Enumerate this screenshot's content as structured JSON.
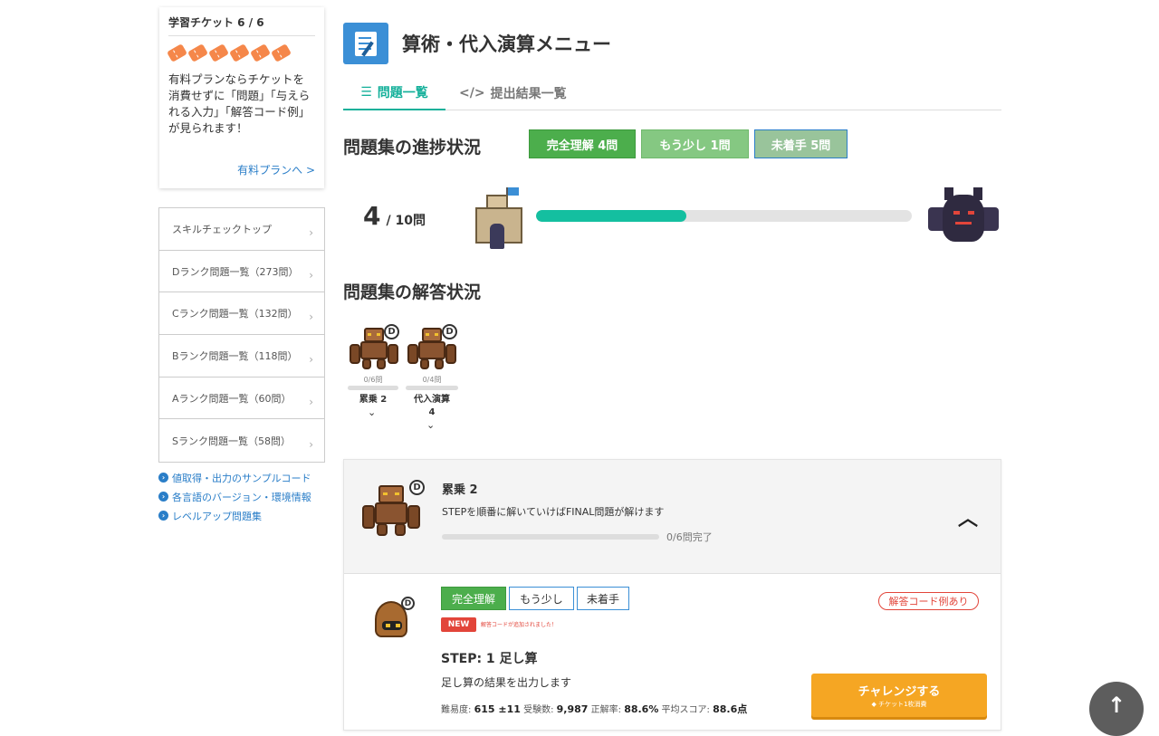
{
  "ticket": {
    "title": "学習チケット 6 / 6",
    "count": 6,
    "note": "有料プランならチケットを消費せずに「問題」「与えられる入力」「解答コード例」が見られます！",
    "link": "有料プランへ >"
  },
  "nav": {
    "items": [
      "スキルチェックトップ",
      "Dランク問題一覧（273問）",
      "Cランク問題一覧（132問）",
      "Bランク問題一覧（118問）",
      "Aランク問題一覧（60問）",
      "Sランク問題一覧（58問）"
    ],
    "chevron": "›"
  },
  "links": [
    "値取得・出力のサンプルコード",
    "各言語のバージョン・環境情報",
    "レベルアップ問題集"
  ],
  "header": {
    "title": "算術・代入演算メニュー"
  },
  "tabs": {
    "problems": "問題一覧",
    "results": "提出結果一覧",
    "problems_icon": "list-icon",
    "results_icon": "code-icon"
  },
  "progress": {
    "title": "問題集の進捗状況",
    "badges": {
      "complete": "完全理解 4問",
      "almost": "もう少し 1問",
      "untouched": "未着手 5問"
    },
    "done": "4",
    "total": "/ 10問",
    "fraction": 0.4
  },
  "answers": {
    "title": "問題集の解答状況",
    "sets": [
      {
        "rank": "D",
        "count": "0/6問",
        "name": "累乗 2"
      },
      {
        "rank": "D",
        "count": "0/4問",
        "name": "代入演算",
        "name2": "4"
      }
    ]
  },
  "card": {
    "rank": "D",
    "title": "累乗 2",
    "desc": "STEPを順番に解いていけばFINAL問題が解けます",
    "progress": "0/6問完了",
    "collapse_icon": "chevron-up-icon"
  },
  "step": {
    "rank": "D",
    "seg": [
      "完全理解",
      "もう少し",
      "未着手"
    ],
    "new": "NEW",
    "new_note": "解答コードが追加されました！",
    "code_pill": "解答コード例あり",
    "title": "STEP: 1 足し算",
    "desc": "足し算の結果を出力します",
    "stats": {
      "difficulty_label": "難易度:",
      "difficulty": "615 ±11",
      "takers_label": "受験数:",
      "takers": "9,987",
      "rate_label": "正解率:",
      "rate": "88.6%",
      "score_label": "平均スコア:",
      "score": "88.6点"
    },
    "challenge": "チャレンジする",
    "challenge_sub": "◆ チケット1枚消費"
  },
  "totop": "↑",
  "colors": {
    "accent": "#14b09a",
    "complete": "#4cae4c",
    "almost": "#85c882",
    "untouched": "#99c49b",
    "challenge": "#f5a623",
    "link": "#2a7ec8"
  }
}
